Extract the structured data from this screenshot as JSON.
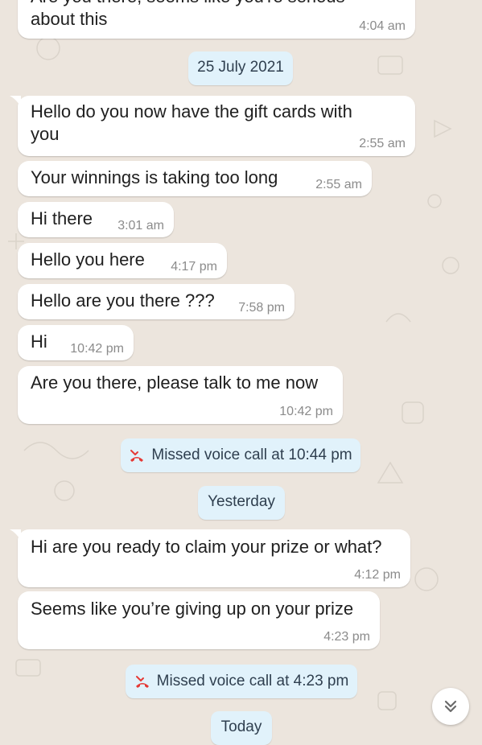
{
  "colors": {
    "wallpaper": "#ece5dd",
    "bubble": "#ffffff",
    "date_pill": "#e1f2fb",
    "missed_call_icon": "#e53935",
    "text": "#202020",
    "time": "#8b8b8b"
  },
  "messages": [
    {
      "text": "Are you there, seems like you're serious\nabout this",
      "time": "4:04 am"
    },
    {
      "text": "Hello do you now have the gift cards with\nyou",
      "time": "2:55 am"
    },
    {
      "text": "Your winnings is taking too long",
      "time": "2:55 am"
    },
    {
      "text": "Hi there",
      "time": "3:01 am"
    },
    {
      "text": "Hello you here",
      "time": "4:17 pm"
    },
    {
      "text": "Hello are you there ???",
      "time": "7:58 pm"
    },
    {
      "text": "Hi",
      "time": "10:42 pm"
    },
    {
      "text": "Are you there, please talk to me now",
      "time": "10:42 pm"
    },
    {
      "text": "Hi are you ready to claim your prize or what?",
      "time": "4:12 pm"
    },
    {
      "text": "Seems like you’re giving up on your prize",
      "time": "4:23 pm"
    }
  ],
  "date_separators": [
    "25 July 2021",
    "Yesterday",
    "Today"
  ],
  "missed_calls": [
    {
      "label": "Missed voice call at 10:44 pm",
      "icon": "missed-call-icon"
    },
    {
      "label": "Missed voice call at 4:23 pm",
      "icon": "missed-call-icon"
    }
  ],
  "scroll_button": {
    "icon": "double-chevron-down-icon"
  }
}
